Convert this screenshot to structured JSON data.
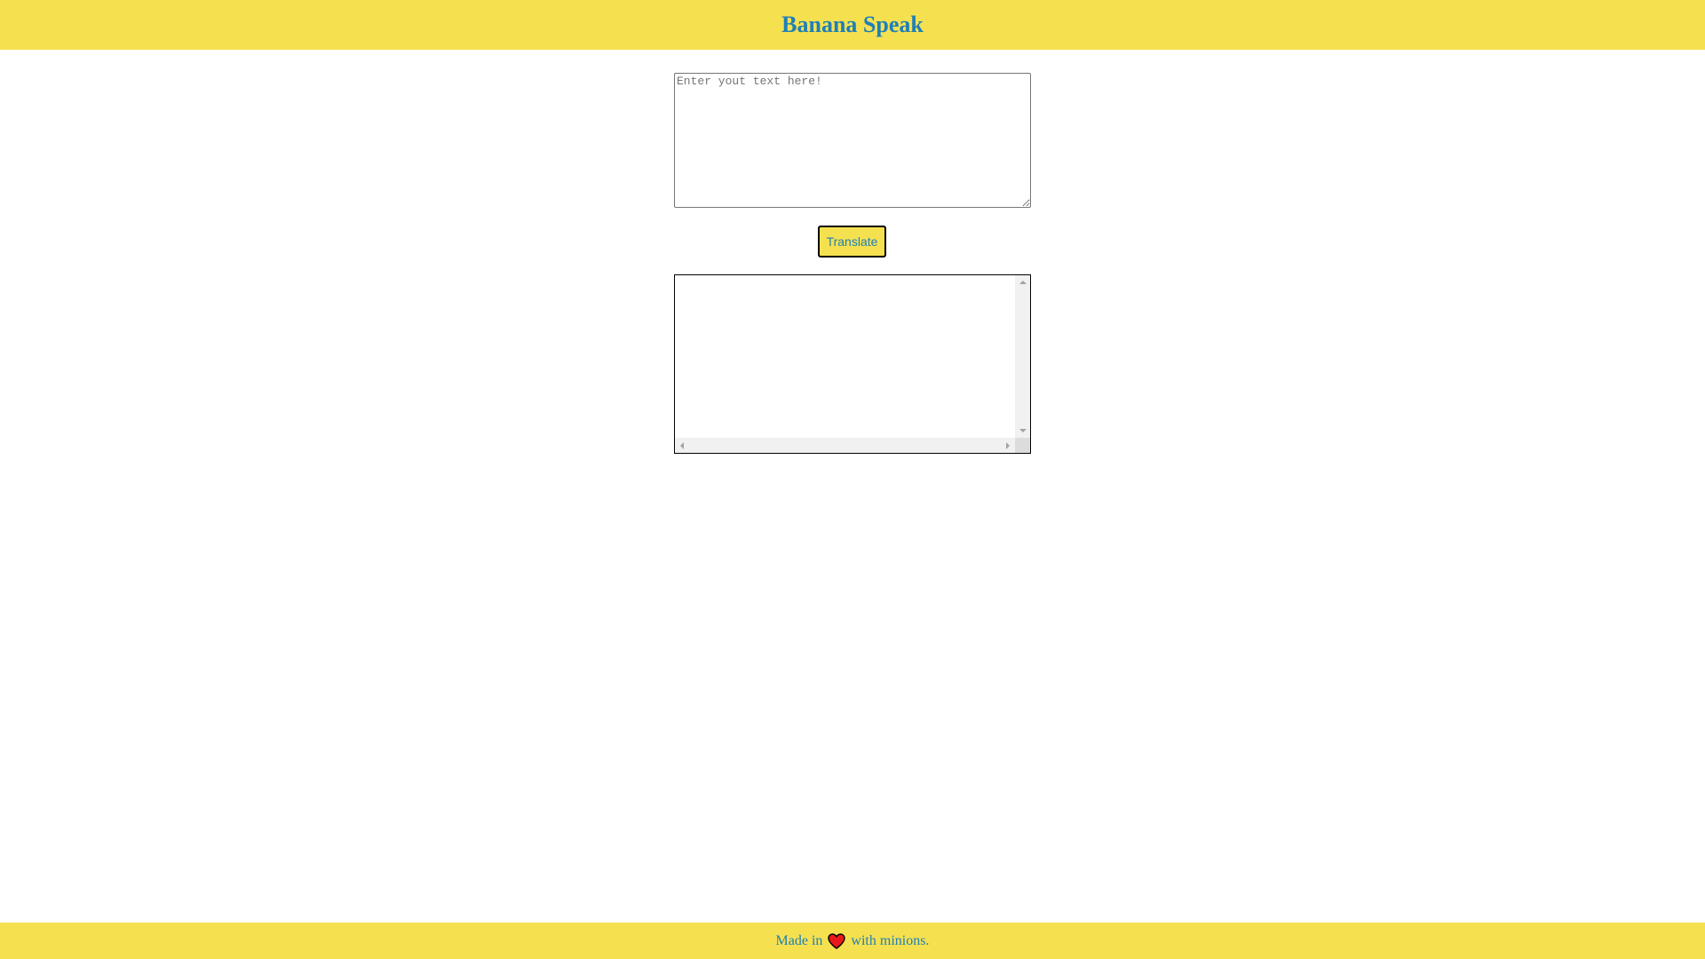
{
  "header": {
    "title": "Banana Speak"
  },
  "input": {
    "placeholder": "Enter yout text here!",
    "value": ""
  },
  "translate_button": {
    "label": "Translate"
  },
  "output": {
    "text": ""
  },
  "footer": {
    "prefix": "Made in",
    "icon": "heart-icon",
    "suffix": "with minions."
  },
  "colors": {
    "brand_yellow": "#f5e14f",
    "text_blue": "#1f7fb8",
    "heart_red": "#e8191b"
  }
}
